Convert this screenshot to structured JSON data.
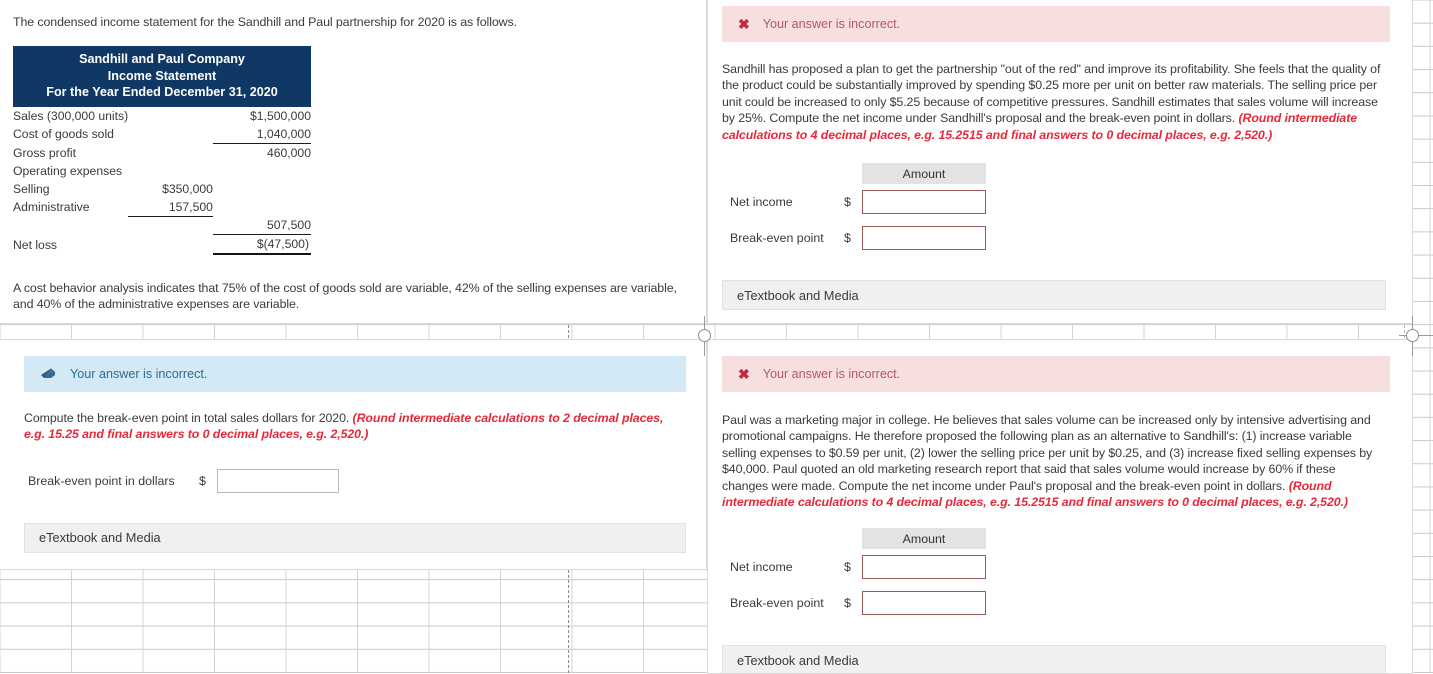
{
  "background": {
    "grid_line_color": "#d4d4d4",
    "page_break_style": "dashed"
  },
  "panels": {
    "top_left": {
      "intro_text": "The condensed income statement for the Sandhill and Paul partnership for 2020 is as follows.",
      "income_statement": {
        "header_color": "#103865",
        "title_lines": [
          "Sandhill and Paul Company",
          "Income Statement",
          "For the Year Ended December 31, 2020"
        ],
        "rows": [
          {
            "label": "Sales (300,000 units)",
            "mid": "",
            "amount": "$1,500,000",
            "rule": "none"
          },
          {
            "label": "Cost of goods sold",
            "mid": "",
            "amount": "1,040,000",
            "rule": "thin"
          },
          {
            "label": "Gross profit",
            "mid": "",
            "amount": "460,000",
            "rule": "none"
          },
          {
            "label": "Operating expenses",
            "mid": "",
            "amount": "",
            "rule": "none"
          },
          {
            "label": "Selling",
            "mid": "$350,000",
            "amount": "",
            "rule": "none"
          },
          {
            "label": "Administrative",
            "mid": "157,500",
            "amount": "",
            "rule": "mid-thin"
          },
          {
            "label": "",
            "mid": "",
            "amount": "507,500",
            "rule": "thin"
          },
          {
            "label": "Net loss",
            "mid": "",
            "amount": "$(47,500",
            "amount_close": ")",
            "rule": "thick"
          }
        ]
      },
      "cost_behavior_note": "A cost behavior analysis indicates that 75% of the cost of goods sold are variable, 42% of the selling expenses are variable, and 40% of the administrative expenses are variable."
    },
    "top_right": {
      "alert": {
        "icon": "x-mark-icon",
        "text": "Your answer is incorrect.",
        "type": "incorrect"
      },
      "question_text": "Sandhill has proposed a plan to get the partnership \"out of the red\" and improve its profitability. She feels that the quality of the product could be substantially improved by spending $0.25 more per unit on better raw materials. The selling price per unit could be increased to only $5.25 because of competitive pressures. Sandhill estimates that sales volume will increase by 25%. Compute the net income under Sandhill's proposal and the break-even point in dollars. ",
      "question_note": "(Round intermediate calculations to 4 decimal places, e.g. 15.2515 and final answers to 0 decimal places, e.g. 2,520.)",
      "table": {
        "column_header": "Amount",
        "rows": [
          {
            "label": "Net income",
            "currency": "$",
            "value": "",
            "placeholder": ""
          },
          {
            "label": "Break-even point",
            "currency": "$",
            "value": "",
            "placeholder": ""
          }
        ]
      },
      "etextbook_label": "eTextbook and Media"
    },
    "bottom_left": {
      "alert": {
        "icon": "eraser-icon",
        "text": "Your answer is incorrect.",
        "type": "info"
      },
      "question_text": "Compute the break-even point in total sales dollars for 2020. ",
      "question_note": "(Round intermediate calculations to 2 decimal places, e.g. 15.25 and final answers to 0 decimal places, e.g. 2,520.)",
      "field": {
        "label": "Break-even point in dollars",
        "currency": "$",
        "value": "",
        "placeholder": ""
      },
      "etextbook_label": "eTextbook and Media"
    },
    "bottom_right": {
      "alert": {
        "icon": "x-mark-icon",
        "text": "Your answer is incorrect.",
        "type": "incorrect"
      },
      "question_text": "Paul was a marketing major in college. He believes that sales volume can be increased only by intensive advertising and promotional campaigns. He therefore proposed the following plan as an alternative to Sandhill's: (1) increase variable selling expenses to $0.59 per unit, (2) lower the selling price per unit by $0.25, and (3) increase fixed selling expenses by $40,000. Paul quoted an old marketing research report that said that sales volume would increase by 60% if these changes were made. Compute the net income under Paul's proposal and the break-even point in dollars. ",
      "question_note": "(Round intermediate calculations to 4 decimal places, e.g. 15.2515 and final answers to 0 decimal places, e.g. 2,520.)",
      "table": {
        "column_header": "Amount",
        "rows": [
          {
            "label": "Net income",
            "currency": "$",
            "value": "",
            "placeholder": ""
          },
          {
            "label": "Break-even point",
            "currency": "$",
            "value": "",
            "placeholder": ""
          }
        ]
      },
      "etextbook_label": "eTextbook and Media"
    }
  },
  "colors": {
    "header_navy": "#103865",
    "alert_incorrect_bg": "#f7dfe0",
    "alert_incorrect_text": "#b05a62",
    "alert_info_bg": "#d3e9f5",
    "alert_info_text": "#2c6d8e",
    "red_note": "#e8293a",
    "input_error_border": "#9c5b5b",
    "etextbook_bg": "#f0f0f0"
  }
}
